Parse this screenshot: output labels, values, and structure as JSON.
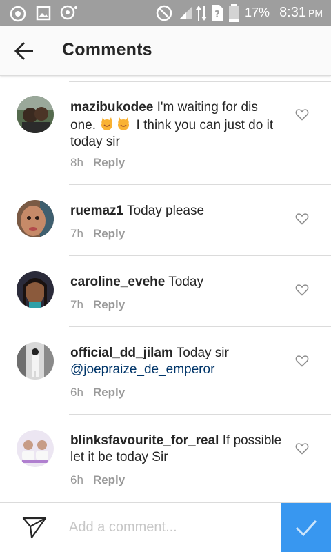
{
  "status_bar": {
    "battery_percent": "17%",
    "time": "8:31",
    "ampm": "PM",
    "icons": [
      "record-icon",
      "image-icon",
      "assistant-icon",
      "do-not-disturb-icon",
      "signal-icon",
      "data-arrows-icon",
      "sim-unknown-icon",
      "battery-icon"
    ]
  },
  "header": {
    "title": "Comments",
    "back_icon": "back-arrow-icon"
  },
  "comments": [
    {
      "username": "mazibukodee",
      "text_before_emoji": " I'm waiting for dis one. ",
      "emoji_count": 2,
      "text_after_emoji": " I think you can just do it today sir",
      "time": "8h",
      "reply_label": "Reply"
    },
    {
      "username": "ruemaz1",
      "text": " Today please",
      "time": "7h",
      "reply_label": "Reply"
    },
    {
      "username": "caroline_evehe",
      "text": " Today",
      "time": "7h",
      "reply_label": "Reply"
    },
    {
      "username": "official_dd_jilam",
      "text": " Today sir",
      "mention": "@joepraize_de_emperor",
      "time": "6h",
      "reply_label": "Reply"
    },
    {
      "username": "blinksfavourite_for_real",
      "text": " If possible let it be today Sir",
      "time": "6h",
      "reply_label": "Reply"
    }
  ],
  "composer": {
    "placeholder": "Add a comment...",
    "value": ""
  },
  "colors": {
    "status_bar": "#9e9e9e",
    "accent": "#3897f0",
    "mention": "#003569",
    "meta": "#999999"
  }
}
